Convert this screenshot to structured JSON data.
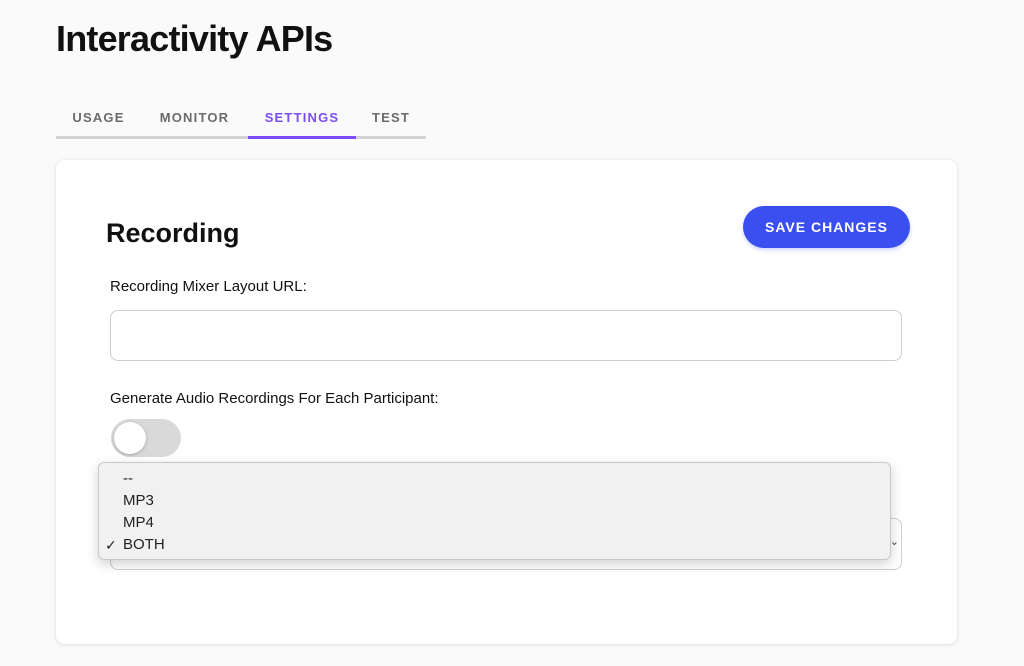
{
  "page": {
    "title": "Interactivity APIs"
  },
  "tabs": [
    {
      "label": "USAGE",
      "active": false
    },
    {
      "label": "MONITOR",
      "active": false
    },
    {
      "label": "SETTINGS",
      "active": true
    },
    {
      "label": "TEST",
      "active": false
    }
  ],
  "settings": {
    "section_title": "Recording",
    "save_label": "SAVE CHANGES",
    "mixer_url_label": "Recording Mixer Layout URL:",
    "mixer_url_value": "",
    "audio_label": "Generate Audio Recordings For Each Participant:",
    "audio_toggle_on": false,
    "format_select": {
      "selected": "BOTH",
      "options": [
        "--",
        "MP3",
        "MP4",
        "BOTH"
      ]
    }
  },
  "icons": {
    "check": "check-icon",
    "chevron": "chevron-updown-icon"
  },
  "colors": {
    "accent": "#7c4dff",
    "button": "#3b4ff0",
    "toggle_off": "#d9d9d9"
  }
}
